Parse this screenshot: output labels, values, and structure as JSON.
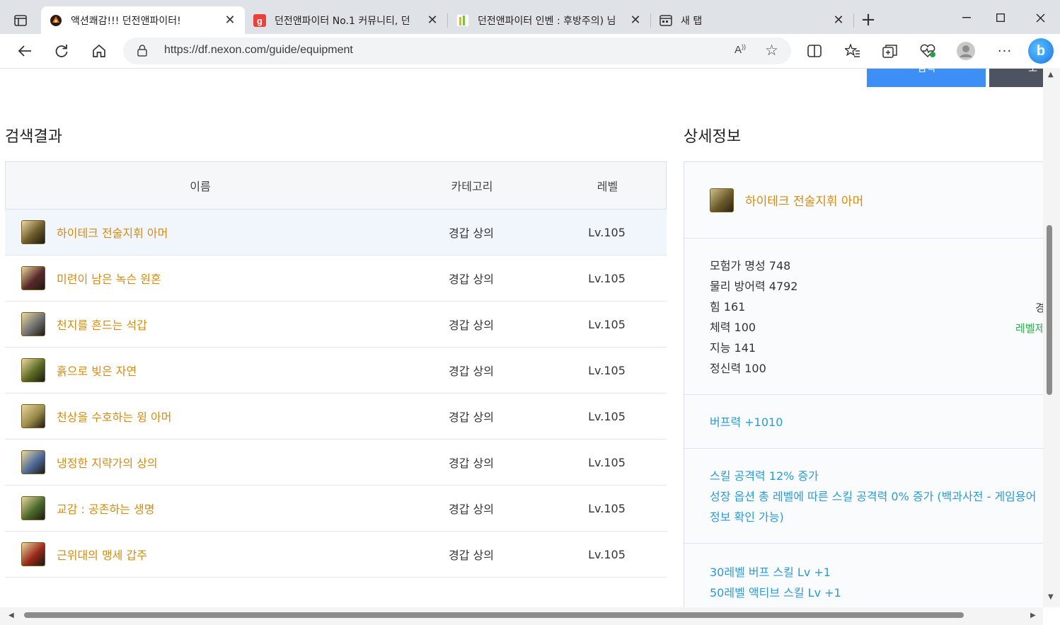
{
  "browser": {
    "tabs": [
      {
        "title": "액션쾌감!!! 던전앤파이터!",
        "favicon": "dnf-icon",
        "active": true
      },
      {
        "title": "던전앤파이터 No.1 커뮤니티, 던",
        "favicon": "g-icon",
        "active": false
      },
      {
        "title": "던전앤파이터 인벤 : 후방주의) 님",
        "favicon": "inven-icon",
        "active": false
      },
      {
        "title": "새 탭",
        "favicon": "newtab-icon",
        "active": false
      }
    ],
    "url": "https://df.nexon.com/guide/equipment",
    "read_aloud": "A",
    "read_aloud_sup": "))"
  },
  "page": {
    "search_button": "검색",
    "reset_button": "초",
    "results_title": "검색결과",
    "detail_title": "상세정보",
    "table": {
      "headers": {
        "name": "이름",
        "category": "카테고리",
        "level": "레벨"
      },
      "rows": [
        {
          "name": "하이테크 전술지휘 아머",
          "category": "경갑 상의",
          "level": "Lv.105",
          "icon_color": "#6b5a2a"
        },
        {
          "name": "미련이 남은 녹슨 원혼",
          "category": "경갑 상의",
          "level": "Lv.105",
          "icon_color": "#5a2a2a"
        },
        {
          "name": "천지를 흔드는 석갑",
          "category": "경갑 상의",
          "level": "Lv.105",
          "icon_color": "#707070"
        },
        {
          "name": "흙으로 빚은 자연",
          "category": "경갑 상의",
          "level": "Lv.105",
          "icon_color": "#5b6a22"
        },
        {
          "name": "천상을 수호하는 윙 아머",
          "category": "경갑 상의",
          "level": "Lv.105",
          "icon_color": "#9a8a4a"
        },
        {
          "name": "냉정한 지략가의 상의",
          "category": "경갑 상의",
          "level": "Lv.105",
          "icon_color": "#4d6a9a"
        },
        {
          "name": "교감 : 공존하는 생명",
          "category": "경갑 상의",
          "level": "Lv.105",
          "icon_color": "#4a6a2a"
        },
        {
          "name": "근위대의 맹세 갑주",
          "category": "경갑 상의",
          "level": "Lv.105",
          "icon_color": "#9a2a1a"
        }
      ]
    },
    "detail": {
      "name": "하이테크 전술지휘 아머",
      "stats": [
        "모험가 명성 748",
        "물리 방어력 4792",
        "힘 161",
        "체력 100",
        "지능 141",
        "정신력 100"
      ],
      "side_notes": {
        "gyeong": "경",
        "level_req": "레벨제"
      },
      "buff": "버프력 +1010",
      "options": [
        "스킬 공격력 12% 증가",
        "성장 옵션 총 레벨에 따른 스킬 공격력 0% 증가 (백과사전 - 게임용어",
        "정보 확인 가능)"
      ],
      "skills": [
        "30레벨 버프 스킬 Lv +1",
        "50레벨 액티브 스킬 Lv +1"
      ]
    }
  },
  "colors": {
    "accent_orange": "#d58b12",
    "accent_blue": "#2a9bd5",
    "search_blue": "#3d8ef5",
    "level_green": "#2bb24c"
  }
}
